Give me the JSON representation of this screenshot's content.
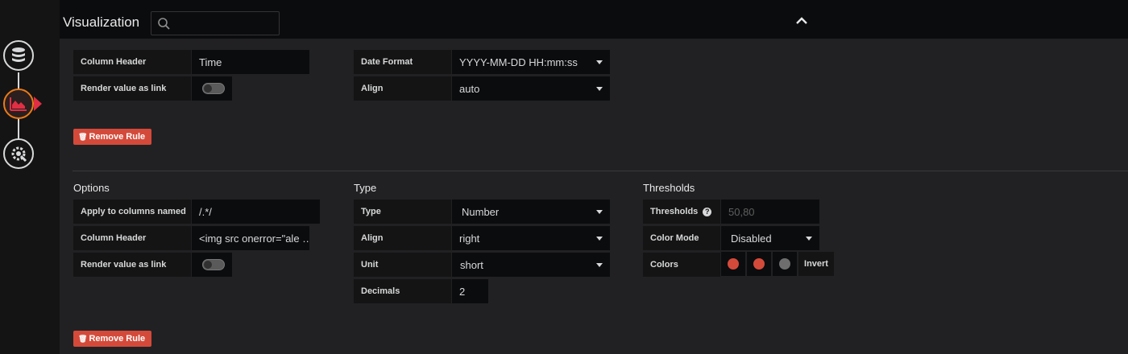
{
  "panel": {
    "title": "Visualization",
    "search_placeholder": ""
  },
  "rule1": {
    "column_header_label": "Column Header",
    "column_header_value": "Time",
    "render_link_label": "Render value as link",
    "date_format_label": "Date Format",
    "date_format_value": "YYYY-MM-DD HH:mm:ss",
    "align_label": "Align",
    "align_value": "auto",
    "remove_label": "Remove Rule"
  },
  "rule2": {
    "options_title": "Options",
    "type_title": "Type",
    "thresholds_title": "Thresholds",
    "apply_label": "Apply to columns named",
    "apply_value": "/.*/",
    "column_header_label": "Column Header",
    "column_header_value": "<img src onerror=\"ale …",
    "render_link_label": "Render value as link",
    "type_label": "Type",
    "type_value": "Number",
    "align_label": "Align",
    "align_value": "right",
    "unit_label": "Unit",
    "unit_value": "short",
    "decimals_label": "Decimals",
    "decimals_value": "2",
    "thresholds_label": "Thresholds",
    "thresholds_placeholder": "50,80",
    "color_mode_label": "Color Mode",
    "color_mode_value": "Disabled",
    "colors_label": "Colors",
    "invert_label": "Invert",
    "remove_label": "Remove Rule"
  },
  "colors": {
    "swatch1": "#d44a3a",
    "swatch2": "#d44a3a",
    "swatch3": "#6e6e6e",
    "accent": "#eb7b18"
  },
  "icons": {
    "queries": "database-icon",
    "visualization": "chart-icon",
    "general": "gear-icon",
    "search": "search-icon",
    "collapse": "chevron-up-icon",
    "remove": "trash-icon",
    "help": "question-icon"
  }
}
